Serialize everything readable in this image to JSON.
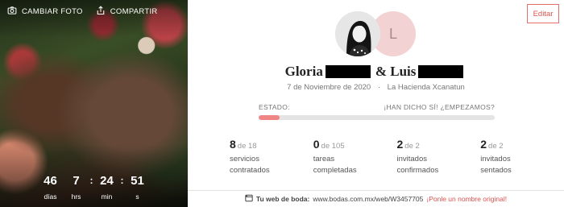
{
  "photo": {
    "change_photo_label": "CAMBIAR FOTO",
    "share_label": "COMPARTIR",
    "icons": {
      "change_photo": "camera-icon",
      "share": "share-icon"
    }
  },
  "countdown": {
    "days": {
      "value": "46",
      "label": "días"
    },
    "hours": {
      "value": "7",
      "label": "hrs"
    },
    "minutes": {
      "value": "24",
      "label": "min"
    },
    "seconds": {
      "value": "51",
      "label": "s"
    },
    "separator": ":"
  },
  "edit_label": "Editar",
  "couple": {
    "name1": "Gloria",
    "connector": "& Luis",
    "initial": "L"
  },
  "event": {
    "date": "7 de Noviembre de 2020",
    "separator": "·",
    "venue": "La Hacienda Xcanatun"
  },
  "status": {
    "label": "ESTADO:",
    "message": "¡HAN DICHO SÍ! ¿EMPEZAMOS?",
    "progress": 0.09
  },
  "stats": [
    {
      "value": "8",
      "of": "de 18",
      "line1": "servicios",
      "line2": "contratados"
    },
    {
      "value": "0",
      "of": "de 105",
      "line1": "tareas",
      "line2": "completadas"
    },
    {
      "value": "2",
      "of": "de 2",
      "line1": "invitados",
      "line2": "confirmados"
    },
    {
      "value": "2",
      "of": "de 2",
      "line1": "invitados",
      "line2": "sentados"
    }
  ],
  "wedding_web": {
    "label": "Tu web de boda:",
    "url": "www.bodas.com.mx/web/W3457705",
    "cta": "¡Ponle un nombre original!",
    "icon": "web-icon"
  },
  "colors": {
    "accent": "#d9534f",
    "progress_fill": "#f08585",
    "avatar_initial_bg": "#f2d2d2"
  }
}
